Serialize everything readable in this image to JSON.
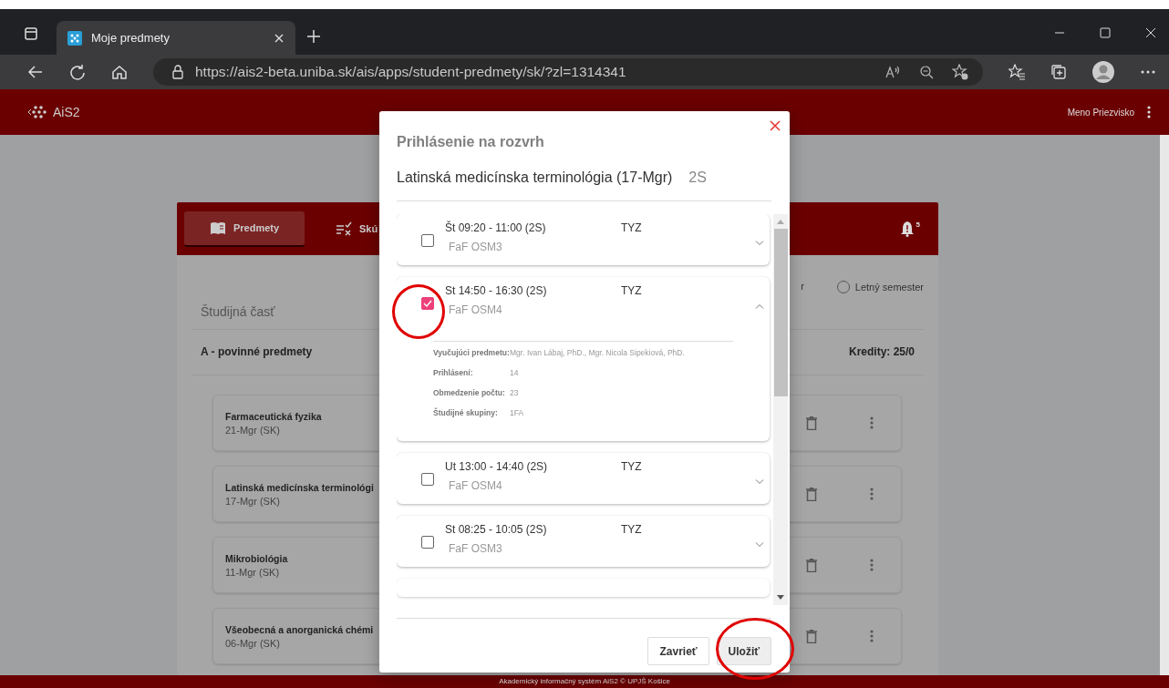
{
  "browser": {
    "tab_title": "Moje predmety",
    "url": "https://ais2-beta.uniba.sk/ais/apps/student-predmety/sk/?zl=1314341"
  },
  "app": {
    "logo": "AiS2",
    "user": "Meno Priezvisko"
  },
  "nav_tabs": [
    {
      "label": "Predmety",
      "selected": true
    },
    {
      "label": "Skú",
      "selected": false
    }
  ],
  "notifications": {
    "count": "5"
  },
  "semester_fragment": "r",
  "semester_options": [
    {
      "label": "Letný semester",
      "selected": false
    }
  ],
  "section_label": "Študijná časť",
  "group": {
    "title": "A - povinné predmety",
    "credits": "Kredity: 25/0"
  },
  "subjects": [
    {
      "name": "Farmaceutická fyzika",
      "code": "21-Mgr (SK)"
    },
    {
      "name": "Latinská medicínska terminológi",
      "code": "17-Mgr (SK)"
    },
    {
      "name": "Mikrobiológia",
      "code": "11-Mgr (SK)"
    },
    {
      "name": "Všeobecná a anorganická chémi",
      "code": "06-Mgr (SK)"
    }
  ],
  "dialog": {
    "title": "Prihlásenie na rozvrh",
    "subject": "Latinská medicínska terminológia (17-Mgr)",
    "term": "2S",
    "slots": [
      {
        "time": "Št 09:20 - 11:00 (2S)",
        "type": "TYZ",
        "room": "FaF OSM3",
        "checked": false,
        "expanded": false
      },
      {
        "time": "St 14:50 - 16:30 (2S)",
        "type": "TYZ",
        "room": "FaF OSM4",
        "checked": true,
        "expanded": true,
        "details": [
          {
            "label": "Vyučujúci predmetu:",
            "value": "Mgr. Ivan Lábaj, PhD., Mgr. Nicola Sipekiová, PhD."
          },
          {
            "label": "Prihlásení:",
            "value": "14"
          },
          {
            "label": "Obmedzenie počtu:",
            "value": "23"
          },
          {
            "label": "Študijné skupiny:",
            "value": "1FA"
          }
        ]
      },
      {
        "time": "Ut 13:00 - 14:40 (2S)",
        "type": "TYZ",
        "room": "FaF OSM4",
        "checked": false,
        "expanded": false
      },
      {
        "time": "St 08:25 - 10:05 (2S)",
        "type": "TYZ",
        "room": "FaF OSM3",
        "checked": false,
        "expanded": false
      }
    ],
    "buttons": [
      {
        "label": "Zavrieť",
        "kind": "secondary"
      },
      {
        "label": "Uložiť",
        "kind": "primary"
      }
    ]
  },
  "footer": "Akademický informačný systém AiS2 © UPJŠ Košice"
}
